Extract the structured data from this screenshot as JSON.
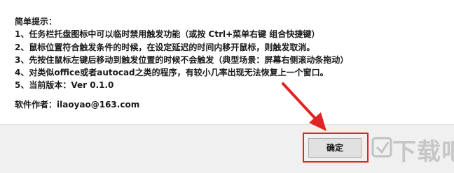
{
  "tips": {
    "heading": "简单提示：",
    "lines": [
      "1、任务栏托盘图标中可以临时禁用触发功能（或按 Ctrl+菜单右键 组合快捷键）",
      "2、鼠标位置符合触发条件的时候，在设定延迟的时间内移开鼠标，则触发取消。",
      "3、先按住鼠标左键后移动到触发位置的时候不会触发（典型场景：屏幕右侧滚动条拖动）",
      "4、对类似office或者autocad之类的程序，有较小几率出现无法恢复上一个窗口。",
      "5、当前版本：Ver 0.1.0"
    ]
  },
  "author": "软件作者：ilaoyao@163.com",
  "ok_button": "确定",
  "watermark": "下载吧",
  "colors": {
    "annotation": "#e02424",
    "footer": "#f0f0f0"
  }
}
